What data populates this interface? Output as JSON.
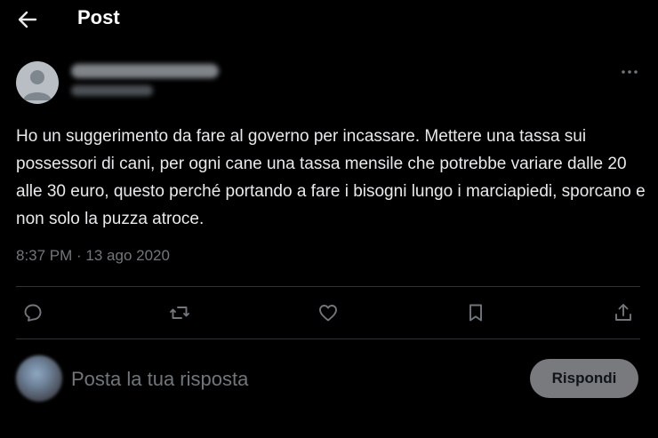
{
  "header": {
    "title": "Post",
    "back_icon": "arrow-left-icon"
  },
  "post": {
    "text": "Ho un suggerimento da fare al governo per incassare. Mettere una tassa sui possessori di cani, per ogni cane una tassa mensile che potrebbe variare dalle 20 alle 30 euro, questo perché portando a fare i bisogni lungo i marciapiedi, sporcano e non solo la puzza atroce.",
    "timestamp": "8:37 PM · 13 ago 2020",
    "more_icon": "more-horizontal-icon"
  },
  "actions": [
    "reply-icon",
    "repost-icon",
    "like-icon",
    "bookmark-icon",
    "share-icon"
  ],
  "reply": {
    "placeholder": "Posta la tua risposta",
    "button_label": "Rispondi"
  },
  "colors": {
    "background": "#000000",
    "text": "#e7e9ea",
    "secondary_text": "#71767b",
    "divider": "#2f3336",
    "reply_button": "#787a7d"
  }
}
